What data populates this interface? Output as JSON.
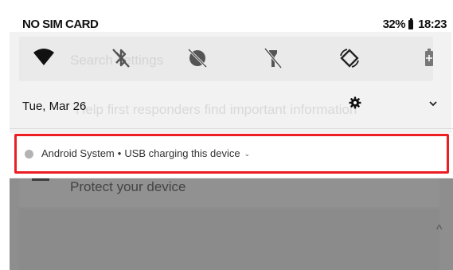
{
  "status_bar": {
    "carrier": "NO SIM CARD",
    "battery": "32%",
    "time": "18:23"
  },
  "quick_settings": {
    "icons": [
      "wifi-icon",
      "bluetooth-off-icon",
      "do-not-disturb-off-icon",
      "flashlight-off-icon",
      "auto-rotate-icon",
      "battery-saver-icon"
    ]
  },
  "header": {
    "date": "Tue, Mar 26"
  },
  "notification": {
    "app": "Android System",
    "separator": "•",
    "message": "USB charging this device",
    "expand_glyph": "⌄",
    "highlight_color": "#ec1e24"
  },
  "background": {
    "search_placeholder": "Search settings",
    "banner": "Help first responders find important information",
    "card_title": "Protect your device"
  }
}
